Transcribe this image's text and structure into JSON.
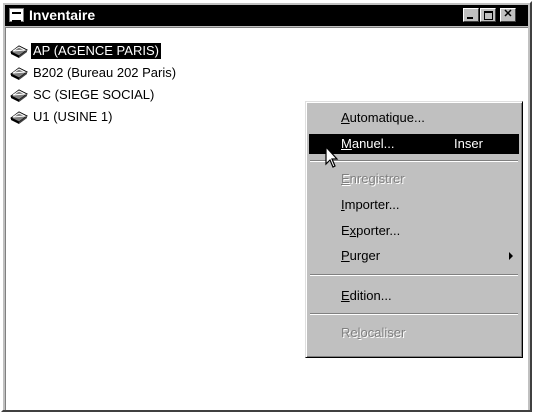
{
  "window": {
    "title": "Inventaire"
  },
  "list": {
    "items": [
      {
        "label": "AP (AGENCE PARIS)",
        "selected": true
      },
      {
        "label": "B202 (Bureau 202 Paris)",
        "selected": false
      },
      {
        "label": "SC (SIEGE SOCIAL)",
        "selected": false
      },
      {
        "label": "U1 (USINE 1)",
        "selected": false
      }
    ]
  },
  "context_menu": {
    "items": [
      {
        "pre": "",
        "key": "A",
        "post": "utomatique...",
        "shortcut": "",
        "enabled": true
      },
      {
        "pre": "",
        "key": "M",
        "post": "anuel...",
        "shortcut": "Inser",
        "enabled": true,
        "highlighted": true
      },
      {
        "pre": "",
        "key": "E",
        "post": "nregistrer",
        "shortcut": "",
        "enabled": false
      },
      {
        "pre": "",
        "key": "I",
        "post": "mporter...",
        "shortcut": "",
        "enabled": true
      },
      {
        "pre": "E",
        "key": "x",
        "post": "porter...",
        "shortcut": "",
        "enabled": true
      },
      {
        "pre": "",
        "key": "P",
        "post": "urger",
        "shortcut": "",
        "enabled": true,
        "submenu": true
      },
      {
        "pre": "",
        "key": "E",
        "post": "dition...",
        "shortcut": "",
        "enabled": true
      },
      {
        "pre": "Re",
        "key": "l",
        "post": "ocaliser",
        "shortcut": "",
        "enabled": false
      }
    ]
  },
  "icons": {
    "system_menu": "window-menu-icon",
    "item": "book-icon",
    "minimize": "minimize-icon",
    "maximize": "maximize-icon",
    "close": "close-icon",
    "pointer": "arrow-cursor-icon"
  }
}
